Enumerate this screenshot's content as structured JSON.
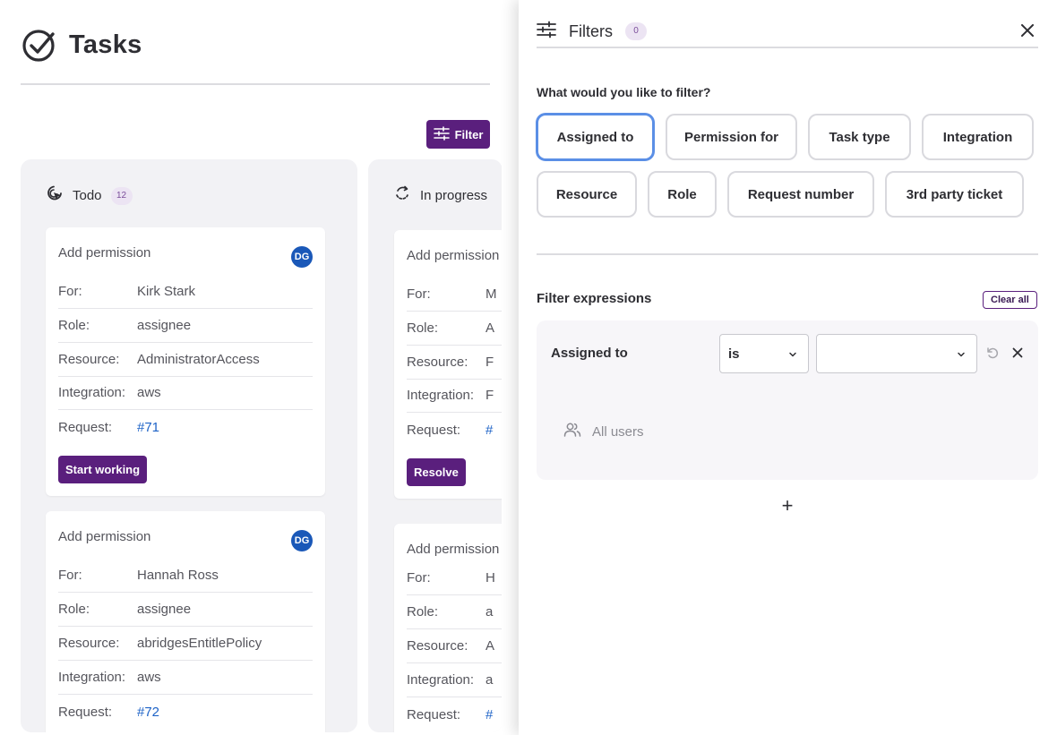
{
  "page": {
    "title": "Tasks"
  },
  "toolbar": {
    "filter_label": "Filter"
  },
  "columns": [
    {
      "title": "Todo",
      "count": "12",
      "cards": [
        {
          "title": "Add permission",
          "avatar": "DG",
          "fields": [
            {
              "label": "For:",
              "value": "Kirk Stark"
            },
            {
              "label": "Role:",
              "value": "assignee"
            },
            {
              "label": "Resource:",
              "value": "AdministratorAccess"
            },
            {
              "label": "Integration:",
              "value": "aws"
            },
            {
              "label": "Request:",
              "value": "#71"
            }
          ],
          "action": "Start working"
        },
        {
          "title": "Add permission",
          "avatar": "DG",
          "fields": [
            {
              "label": "For:",
              "value": "Hannah Ross"
            },
            {
              "label": "Role:",
              "value": "assignee"
            },
            {
              "label": "Resource:",
              "value": "abridgesEntitlePolicy"
            },
            {
              "label": "Integration:",
              "value": "aws"
            },
            {
              "label": "Request:",
              "value": "#72"
            }
          ]
        }
      ]
    },
    {
      "title": "In progress",
      "cards": [
        {
          "title": "Add permission",
          "fields": [
            {
              "label": "For:",
              "value": "M"
            },
            {
              "label": "Role:",
              "value": "A"
            },
            {
              "label": "Resource:",
              "value": "F"
            },
            {
              "label": "Integration:",
              "value": "F"
            },
            {
              "label": "Request:",
              "value": "#"
            }
          ],
          "action": "Resolve"
        },
        {
          "title": "Add permission",
          "fields": [
            {
              "label": "For:",
              "value": "H"
            },
            {
              "label": "Role:",
              "value": "a"
            },
            {
              "label": "Resource:",
              "value": "A"
            },
            {
              "label": "Integration:",
              "value": "a"
            },
            {
              "label": "Request:",
              "value": "#"
            }
          ]
        }
      ]
    }
  ],
  "drawer": {
    "title": "Filters",
    "count": "0",
    "question": "What would you like to filter?",
    "chips": [
      "Assigned to",
      "Permission for",
      "Task type",
      "Integration",
      "Resource",
      "Role",
      "Request number",
      "3rd party ticket"
    ],
    "active_chip": "Assigned to",
    "expressions_label": "Filter expressions",
    "clear_all_label": "Clear all",
    "expression": {
      "field": "Assigned to",
      "operator": "is",
      "value": "",
      "option": "All users"
    },
    "add_label": "+"
  },
  "colors": {
    "accent": "#5a1f7d",
    "link": "#1e63c7",
    "avatar": "#1a58b8",
    "active_chip_border": "#5b8fe6"
  },
  "icons": [
    "check-circle-icon",
    "sliders-icon",
    "cursor-icon",
    "refresh-icon",
    "close-icon",
    "chevron-down-icon",
    "undo-icon",
    "users-icon"
  ]
}
